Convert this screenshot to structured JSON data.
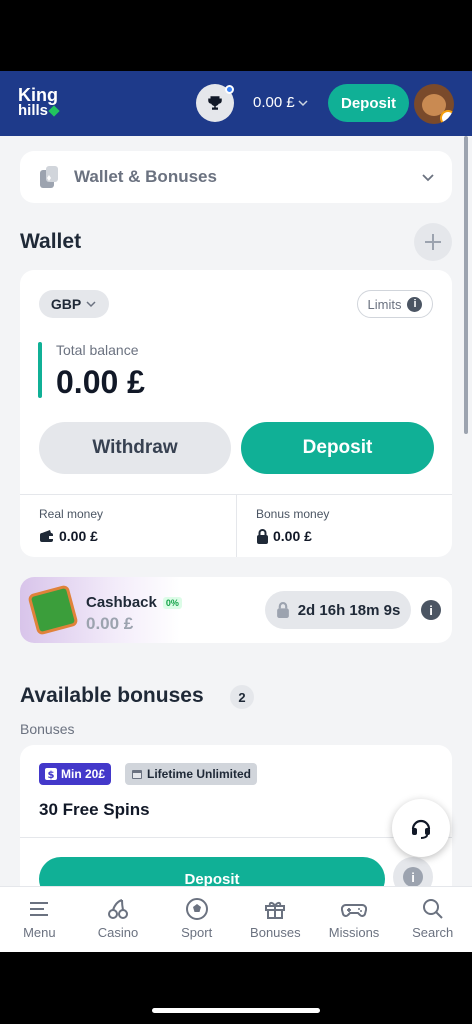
{
  "header": {
    "logo_line1": "King",
    "logo_line2": "hills",
    "balance": "0.00 £",
    "deposit_label": "Deposit"
  },
  "wallet_bonuses": {
    "title": "Wallet & Bonuses"
  },
  "wallet": {
    "section_title": "Wallet",
    "currency": "GBP",
    "limits_label": "Limits",
    "total_balance_label": "Total balance",
    "total_balance_value": "0.00 £",
    "withdraw_label": "Withdraw",
    "deposit_label": "Deposit",
    "real_money_label": "Real money",
    "real_money_value": "0.00 £",
    "bonus_money_label": "Bonus money",
    "bonus_money_value": "0.00 £"
  },
  "cashback": {
    "title": "Cashback",
    "percent": "0%",
    "value": "0.00 £",
    "timer": "2d 16h 18m 9s"
  },
  "available_bonuses": {
    "title": "Available bonuses",
    "count": "2",
    "subtitle": "Bonuses",
    "bonus": {
      "min_tag": "Min 20£",
      "lifetime_tag": "Lifetime Unlimited",
      "name": "30 Free Spins",
      "deposit_label": "Deposit"
    }
  },
  "bottom_nav": [
    {
      "label": "Menu",
      "icon": "menu-icon"
    },
    {
      "label": "Casino",
      "icon": "cherries-icon"
    },
    {
      "label": "Sport",
      "icon": "soccer-ball-icon"
    },
    {
      "label": "Bonuses",
      "icon": "gift-icon"
    },
    {
      "label": "Missions",
      "icon": "gamepad-icon"
    },
    {
      "label": "Search",
      "icon": "search-icon"
    }
  ],
  "colors": {
    "header_bg": "#1e3a8a",
    "accent": "#10b096",
    "page_bg": "#f3f4f6"
  }
}
